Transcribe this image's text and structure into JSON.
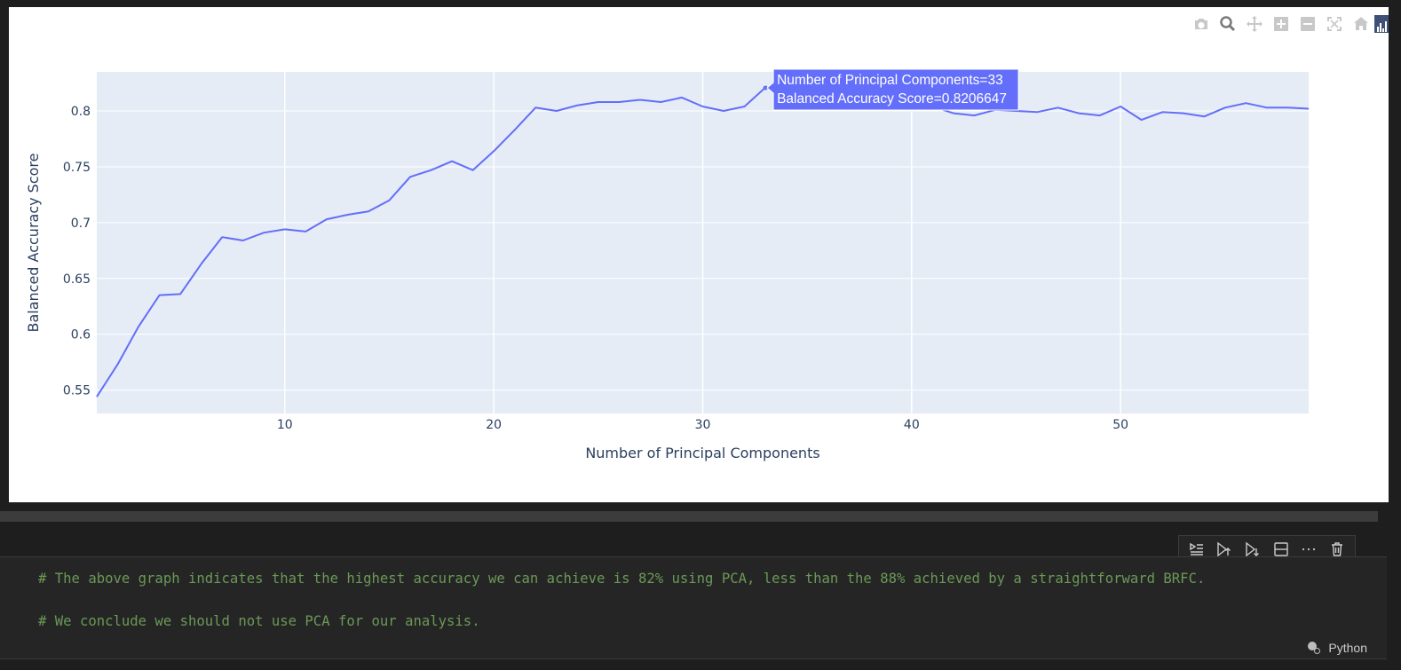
{
  "modebar": {
    "icons": [
      "camera-icon",
      "zoom-icon",
      "pan-icon",
      "zoom-in-icon",
      "zoom-out-icon",
      "autoscale-icon",
      "reset-axes-icon",
      "plotly-logo"
    ],
    "active": "zoom-icon"
  },
  "chart_data": {
    "type": "line",
    "title": "",
    "xlabel": "Number of Principal Components",
    "ylabel": "Balanced Accuracy Score",
    "xlim": [
      1,
      59
    ],
    "ylim": [
      0.529,
      0.835
    ],
    "xticks": [
      10,
      20,
      30,
      40,
      50
    ],
    "yticks": [
      0.55,
      0.6,
      0.65,
      0.7,
      0.75,
      0.8
    ],
    "xtick_labels": [
      "10",
      "20",
      "30",
      "40",
      "50"
    ],
    "ytick_labels": [
      "0.55",
      "0.6",
      "0.65",
      "0.7",
      "0.75",
      "0.8"
    ],
    "grid": true,
    "line_color": "#636efa",
    "plot_background": "#e5ecf6",
    "x": [
      1,
      2,
      3,
      4,
      5,
      6,
      7,
      8,
      9,
      10,
      11,
      12,
      13,
      14,
      15,
      16,
      17,
      18,
      19,
      20,
      21,
      22,
      23,
      24,
      25,
      26,
      27,
      28,
      29,
      30,
      31,
      32,
      33,
      34,
      35,
      36,
      37,
      38,
      39,
      40,
      41,
      42,
      43,
      44,
      45,
      46,
      47,
      48,
      49,
      50,
      51,
      52,
      53,
      54,
      55,
      56,
      57,
      58,
      59
    ],
    "y": [
      0.544,
      0.573,
      0.607,
      0.635,
      0.636,
      0.663,
      0.687,
      0.684,
      0.691,
      0.694,
      0.692,
      0.703,
      0.707,
      0.71,
      0.72,
      0.741,
      0.747,
      0.755,
      0.747,
      0.764,
      0.783,
      0.803,
      0.8,
      0.805,
      0.808,
      0.808,
      0.81,
      0.808,
      0.812,
      0.804,
      0.8,
      0.804,
      0.821,
      0.816,
      0.815,
      0.814,
      0.813,
      0.812,
      0.811,
      0.81,
      0.804,
      0.798,
      0.796,
      0.801,
      0.8,
      0.799,
      0.803,
      0.798,
      0.796,
      0.804,
      0.792,
      0.799,
      0.798,
      0.795,
      0.803,
      0.807,
      0.803,
      0.803,
      0.802
    ],
    "hover": {
      "line1": "Number of Principal Components=33",
      "line2": "Balanced Accuracy Score=0.8206647",
      "x": 33,
      "y": 0.8206647
    }
  },
  "cell_toolbar": {
    "buttons": [
      "run-by-line-icon",
      "execute-above-icon",
      "execute-below-icon",
      "split-cell-icon",
      "more-icon",
      "delete-icon"
    ]
  },
  "code": {
    "line1": "# The above graph indicates that the highest accuracy we can achieve is 82% using PCA, less than the 88% achieved by a straightforward BRFC.",
    "line2": "# We conclude we should not use PCA for our analysis."
  },
  "status": {
    "language": "Python"
  }
}
